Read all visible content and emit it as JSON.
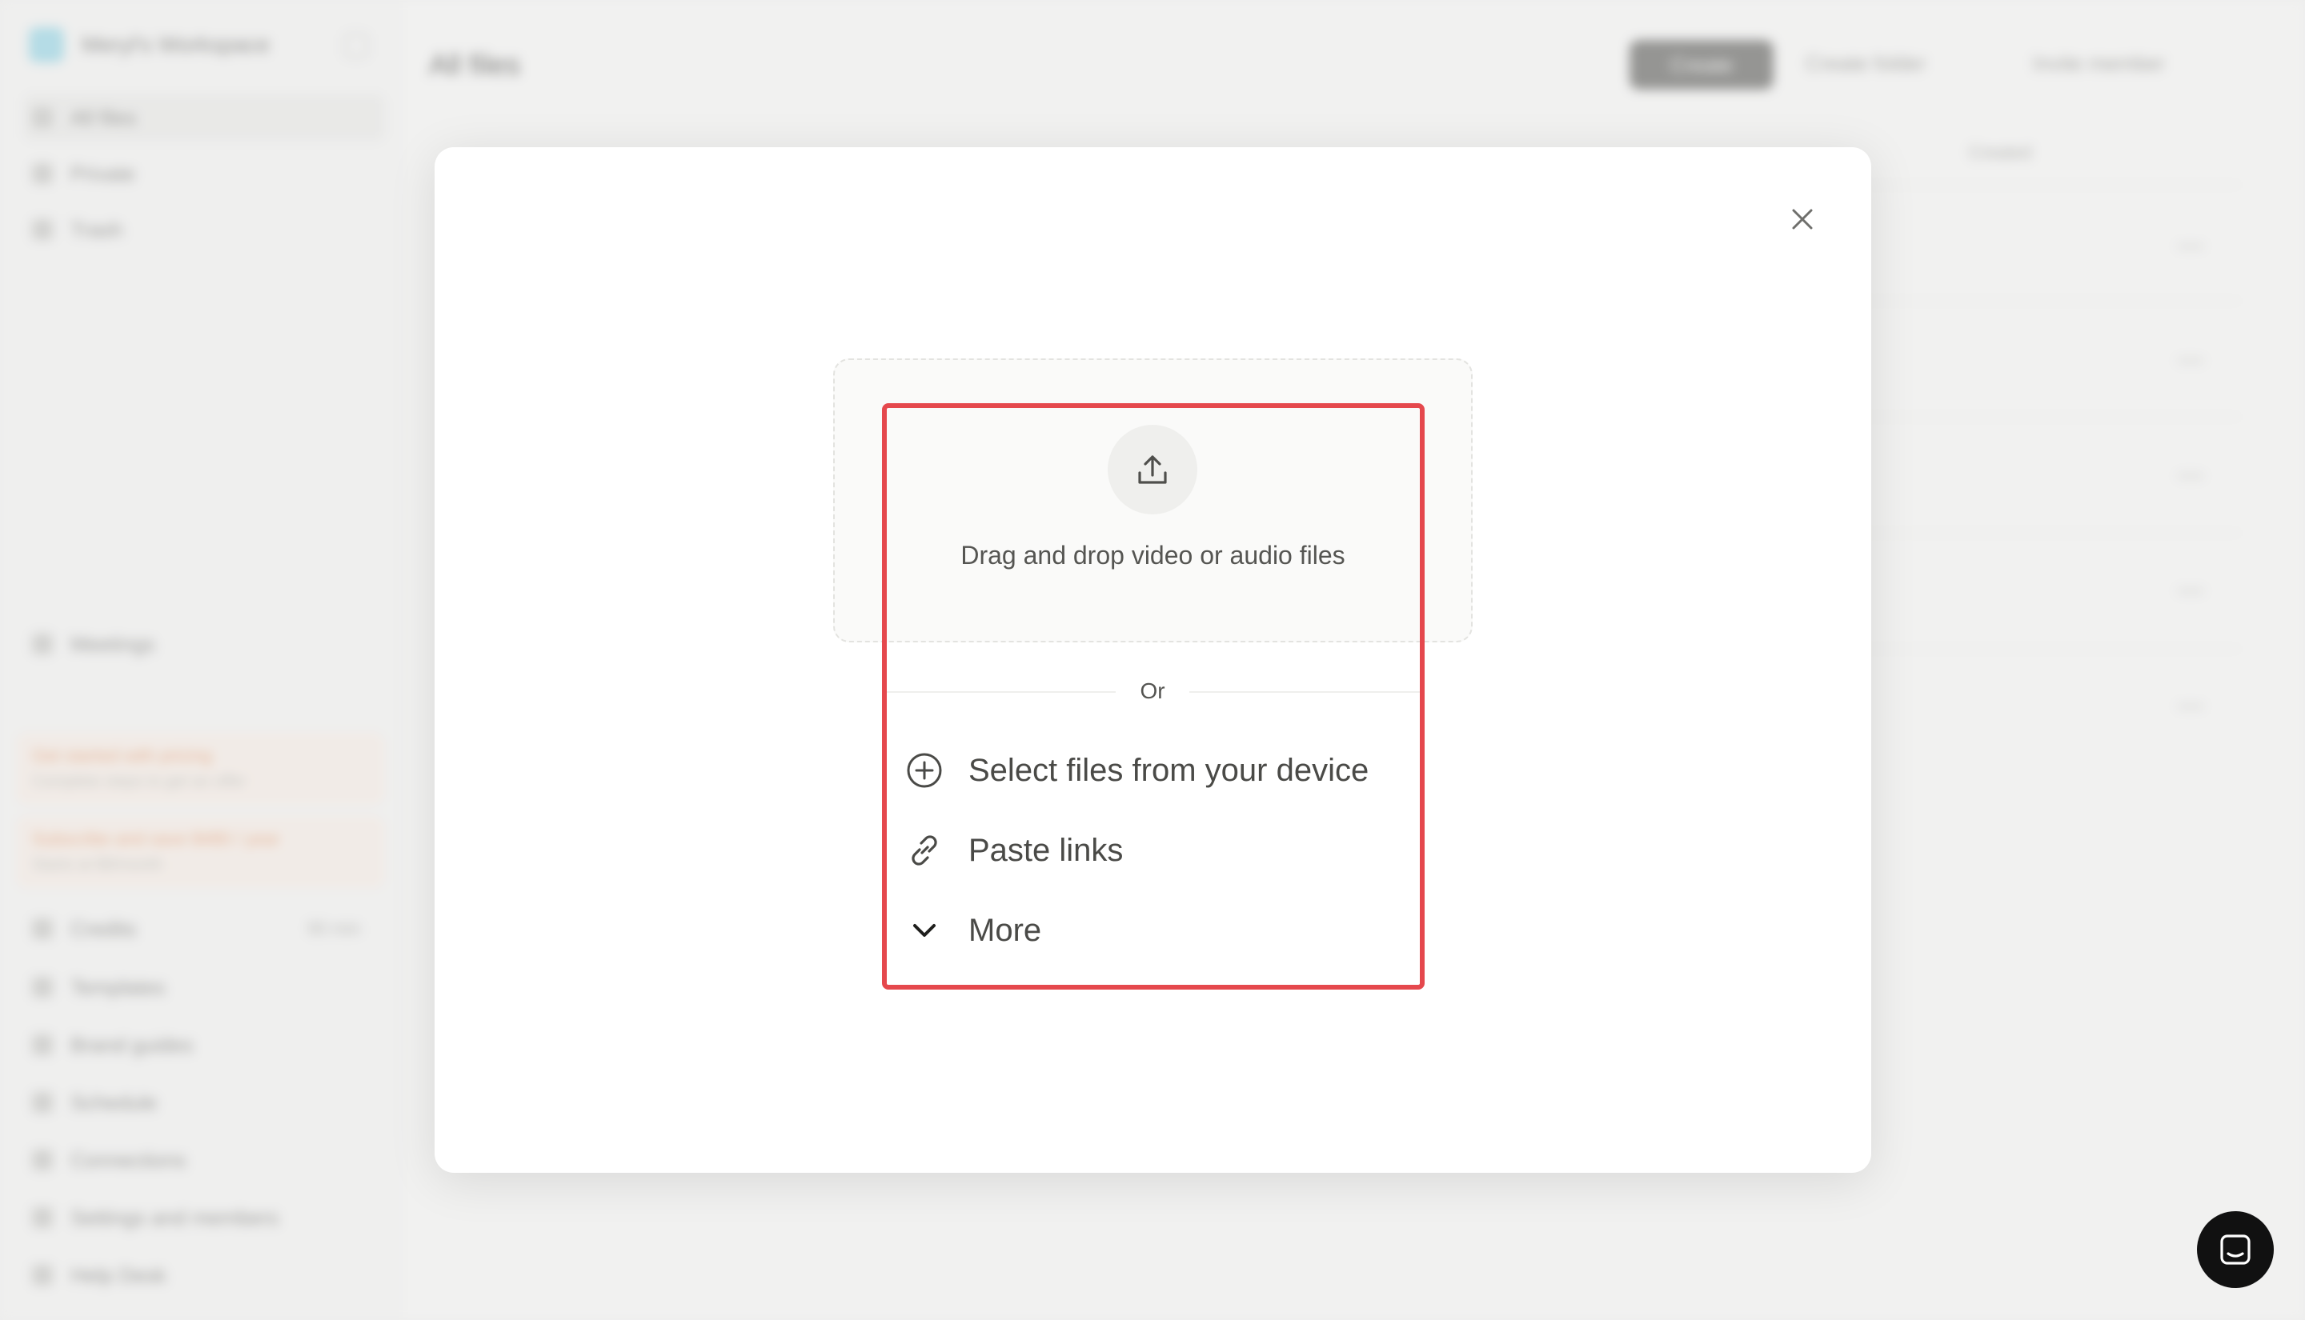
{
  "background": {
    "workspace_name": "Meryl's Workspace",
    "nav": [
      {
        "label": "All files",
        "icon": "home-icon"
      },
      {
        "label": "Private",
        "icon": "lock-icon"
      },
      {
        "label": "Trash",
        "icon": "trash-icon"
      }
    ],
    "meetings_label": "Meetings",
    "promos": [
      {
        "title": "Get started with pricing",
        "subtitle": "Complete steps to get an offer"
      },
      {
        "title": "Subscribe and save $480 / year",
        "subtitle": "Starts at $8/month"
      }
    ],
    "credits": {
      "label": "Credits",
      "count": "90 min"
    },
    "bottom_nav": [
      "Templates",
      "Brand guides",
      "Schedule",
      "Connections",
      "Settings and members",
      "Help Desk"
    ],
    "page_title": "All files",
    "create_label": "Create",
    "top_links": [
      "Create folder",
      "Invite member"
    ],
    "filter_label": "Created"
  },
  "modal": {
    "close_icon": "close-icon",
    "upload_icon": "upload-icon",
    "drop_text": "Drag and drop video or audio files",
    "or_text": "Or",
    "options": [
      {
        "label": "Select files from your device",
        "icon": "plus-circle-icon"
      },
      {
        "label": "Paste links",
        "icon": "link-icon"
      },
      {
        "label": "More",
        "icon": "chevron-down-icon"
      }
    ],
    "highlight_color": "#e5484d"
  },
  "chat_launcher_icon": "chat-icon"
}
